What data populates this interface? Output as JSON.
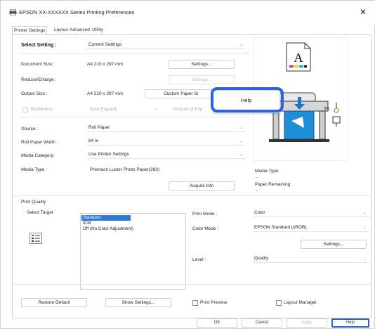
{
  "window": {
    "title": "EPSON XX-XXXXXX Series Printing Preferences",
    "close_glyph": "✕"
  },
  "tabs": [
    "Printer Settings",
    "Layout",
    "Advanced",
    "Utility"
  ],
  "left": {
    "select_setting_label": "Select Setting :",
    "select_setting_value": "Current Settings",
    "document_size_label": "Document Size :",
    "document_size_value": "A4 210 x 297 mm",
    "document_size_button": "Settings...",
    "reduce_enlarge_label": "Reduce/Enlarge :",
    "reduce_enlarge_button": "Settings...",
    "output_size_label": "Output Size :",
    "output_size_value": "A4 210 x 297 mm",
    "custom_paper_button": "Custom Paper Si",
    "borderless_label": "Borderless",
    "auto_expand_value": "Auto Expand",
    "amount_of_expansion": "Amount of Exp",
    "source_label": "Source :",
    "source_value": "Roll Paper",
    "roll_width_label": "Roll Paper Width :",
    "roll_width_value": "64 in",
    "media_category_label": "Media Category:",
    "media_category_value": "Use Printer Settings",
    "media_type_label": "Media Type :",
    "media_type_value": "Premium Luster Photo Paper(260)",
    "acquire_info_button": "Acquire Info"
  },
  "preview": {
    "paper_letter": "A",
    "media_type_caption": "Media Type",
    "media_type_dash": "-",
    "paper_remaining_caption": "Paper Remaining",
    "paper_remaining_dash": "-"
  },
  "print_quality": {
    "header": "Print Quality",
    "select_target_label": "Select Target",
    "options": [
      "Standard",
      "ICM",
      "Off (No Color Adjustment)"
    ],
    "selected_index": 0,
    "print_mode_label": "Print Mode :",
    "print_mode_value": "Color",
    "color_mode_label": "Color Mode :",
    "color_mode_value": "EPSON Standard (sRGB)",
    "color_settings_button": "Settings...",
    "level_label": "Level :",
    "level_value": "Quality"
  },
  "bottom": {
    "restore_default": "Restore Default",
    "show_settings": "Show Settings...",
    "print_preview": "Print Preview",
    "layout_manager": "Layout Manager"
  },
  "context_menu": {
    "help": "Help"
  },
  "footer": {
    "ok": "OK",
    "cancel": "Cancel",
    "apply": "Apply",
    "help": "Help"
  },
  "colors": {
    "highlight_blue": "#2b63d9",
    "selection_blue": "#2f7bd6",
    "printer_arrow": "#1e73c8"
  }
}
